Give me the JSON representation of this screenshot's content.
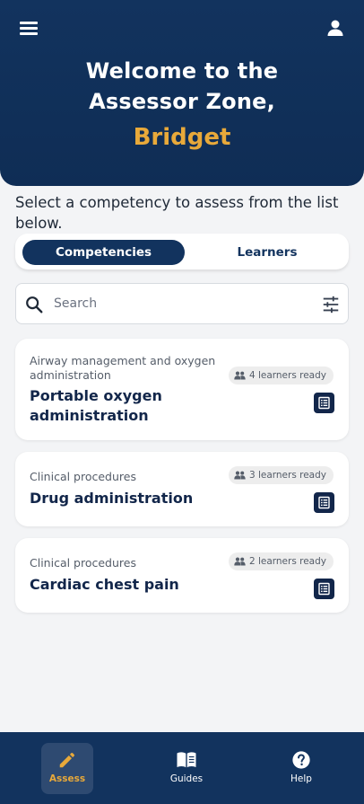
{
  "header": {
    "welcome_line1": "Welcome to the",
    "welcome_line2": "Assessor Zone,",
    "user_name": "Bridget"
  },
  "instruction": "Select a competency to assess from the list below.",
  "tabs": [
    {
      "label": "Competencies",
      "active": true
    },
    {
      "label": "Learners",
      "active": false
    }
  ],
  "search": {
    "placeholder": "Search",
    "value": ""
  },
  "cards": [
    {
      "category": "Airway management and oxygen administration",
      "title": "Portable oxygen administration",
      "ready": "4 learners ready"
    },
    {
      "category": "Clinical procedures",
      "title": "Drug administration",
      "ready": "3 learners ready"
    },
    {
      "category": "Clinical procedures",
      "title": "Cardiac chest pain",
      "ready": "2 learners ready"
    }
  ],
  "bottom_nav": [
    {
      "label": "Assess",
      "icon": "pencil-icon",
      "active": true
    },
    {
      "label": "Guides",
      "icon": "book-icon",
      "active": false
    },
    {
      "label": "Help",
      "icon": "help-icon",
      "active": false
    }
  ],
  "colors": {
    "primary": "#12335e",
    "accent": "#e8a93a",
    "background": "#f3f4f6",
    "card": "#ffffff"
  }
}
